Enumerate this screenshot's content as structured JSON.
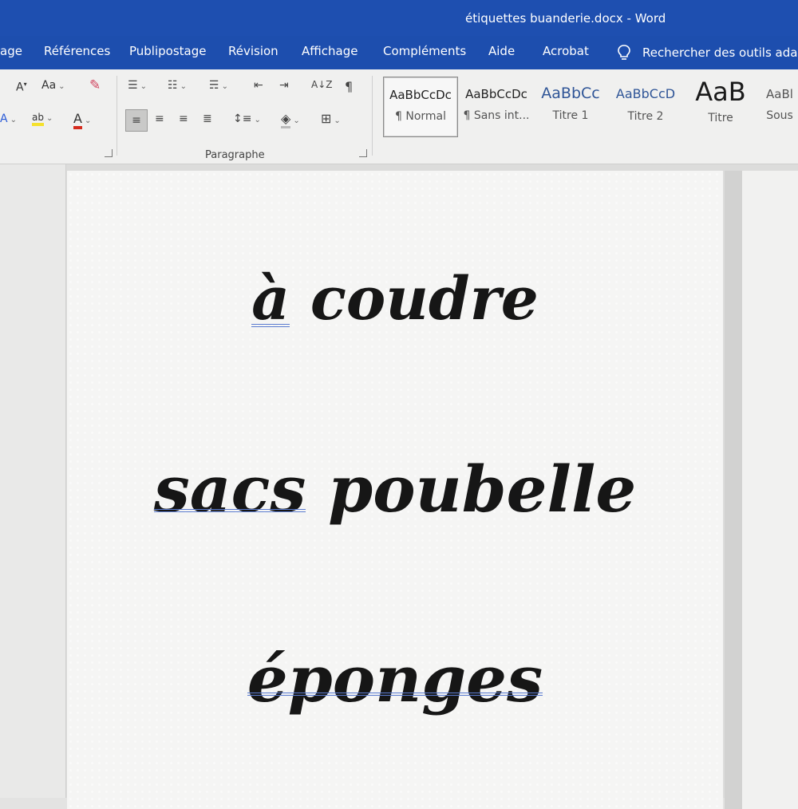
{
  "window": {
    "title": "étiquettes buanderie.docx  -  Word"
  },
  "tabs": [
    "age",
    "Références",
    "Publipostage",
    "Révision",
    "Affichage",
    "Compléments",
    "Aide",
    "Acrobat"
  ],
  "search": {
    "text": "Rechercher des outils adapt",
    "icon": "lightbulb-icon"
  },
  "ribbon": {
    "font_group": {
      "font_case": "Aa",
      "shrink_font": "A",
      "highlight": "ab",
      "font_color": "A"
    },
    "paragraph_group": {
      "label": "Paragraphe",
      "pilcrow": "¶",
      "sort": "A↓Z"
    },
    "styles": [
      {
        "preview": "AaBbCcDc",
        "name": "¶ Normal",
        "selected": true
      },
      {
        "preview": "AaBbCcDc",
        "name": "¶ Sans int...",
        "selected": false
      },
      {
        "preview": "AaBbCc",
        "name": "Titre 1",
        "selected": false
      },
      {
        "preview": "AaBbCcD",
        "name": "Titre 2",
        "selected": false
      },
      {
        "preview": "AaB",
        "name": "Titre",
        "selected": false
      },
      {
        "preview": "AaBl",
        "name": "Sous",
        "selected": false
      }
    ]
  },
  "document": {
    "lines": [
      {
        "words": [
          "à",
          "coudre"
        ]
      },
      {
        "words": [
          "sacs",
          "poubelle"
        ]
      },
      {
        "words": [
          "éponges"
        ]
      }
    ]
  },
  "colors": {
    "title_bar": "#1e4fb0",
    "ribbon_bg": "#f0f0ef",
    "font_color_underline": "#d52b1e",
    "highlight_yellow": "#f5e12c",
    "spell_underline": "#5a7bd0"
  }
}
